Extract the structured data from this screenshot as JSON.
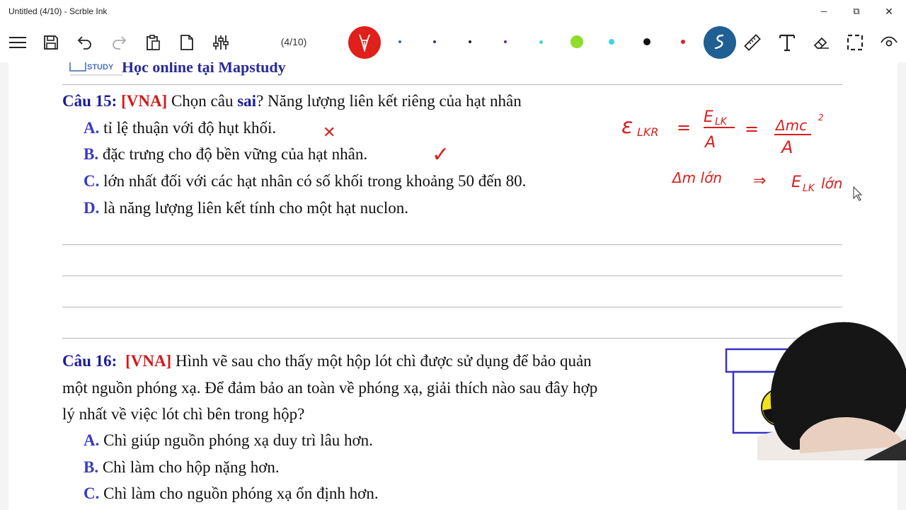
{
  "window": {
    "title": "Untitled (4/10) - Scrble Ink",
    "minimize_label": "─",
    "maximize_label": "⧉",
    "close_label": "✕"
  },
  "toolbar": {
    "page_indicator": "(4/10)",
    "icons": [
      "menu-icon",
      "save-icon",
      "undo-icon",
      "redo-icon",
      "paste-icon",
      "page-icon",
      "sliders-icon",
      "pen-red-icon",
      "ruler-icon",
      "text-icon",
      "eraser-icon",
      "select-icon",
      "view-icon"
    ],
    "colors": [
      "#3b5fc0",
      "#3030a0",
      "#222222",
      "#6b2a8a",
      "#3fd3e3",
      "#8fdc2a",
      "#3fd3e3",
      "#111111",
      "#e0201b"
    ],
    "active_pen_color": "#e0201b",
    "highlighter_color": "#1f5f93"
  },
  "document": {
    "header_brand": "STUDY",
    "header_title": "Học online tại Mapstudy",
    "q15": {
      "number": "Câu 15:",
      "tag": "[VNA]",
      "text_before": "Chọn câu",
      "keyword": "sai",
      "text_after": "? Năng lượng liên kết riêng của hạt nhân",
      "options": [
        {
          "letter": "A.",
          "text": "tỉ lệ thuận với độ hụt khối."
        },
        {
          "letter": "B.",
          "text": "đặc trưng cho độ bền vững của hạt nhân."
        },
        {
          "letter": "C.",
          "text": "lớn nhất đối với các hạt nhân có số khối trong khoảng 50 đến 80."
        },
        {
          "letter": "D.",
          "text": "là năng lượng liên kết tính cho một hạt nuclon."
        }
      ]
    },
    "q16": {
      "number": "Câu 16:",
      "tag": "[VNA]",
      "line1": "Hình vẽ sau cho thấy một hộp lót chì được sử dụng để bảo quản",
      "line2": "một nguồn phóng xạ. Để đảm bảo an toàn về phóng xạ, giải thích nào sau đây hợp",
      "line3": "lý nhất về việc lót chì bên trong hộp?",
      "options": [
        {
          "letter": "A.",
          "text": "Chì giúp nguồn phóng xạ duy trì lâu hơn."
        },
        {
          "letter": "B.",
          "text": "Chì làm cho hộp nặng hơn."
        },
        {
          "letter": "C.",
          "text": "Chì làm cho nguồn phóng xạ ổn định hơn."
        }
      ]
    },
    "handwriting": {
      "formula_lhs": "ε",
      "formula_lhs_sub": "LKR",
      "eq1": "=",
      "frac1_num": "E",
      "frac1_num_sub": "LK",
      "frac1_den": "A",
      "eq2": "=",
      "frac2_num": "Δmc",
      "frac2_num_sup": "2",
      "frac2_den": "A",
      "line2_left": "Δm lớn",
      "arrow": "⇒",
      "line2_right_E": "E",
      "line2_right_sub": "LK",
      "line2_right": "lớn",
      "mark_A": "✕",
      "mark_B": "✓"
    }
  }
}
